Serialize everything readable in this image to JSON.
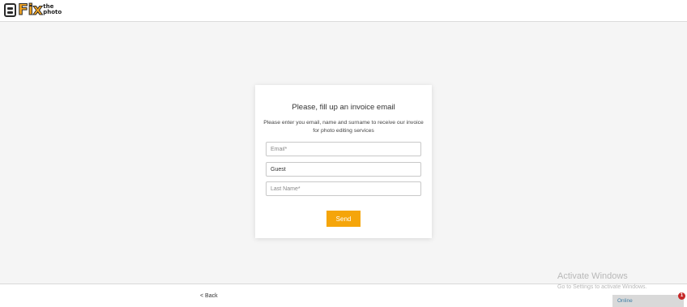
{
  "header": {
    "logo_main": "Fix",
    "logo_small_top": "the",
    "logo_small_bottom": "photo"
  },
  "form": {
    "title": "Please, fill up an invoice email",
    "subtitle": "Please enter you email, name and surname to receive our invoice for photo editing services",
    "email_placeholder": "Email*",
    "name_value": "Guest",
    "lastname_placeholder": "Last Name*",
    "send_label": "Send"
  },
  "footer": {
    "back_label": "< Back"
  },
  "watermark": {
    "title": "Activate Windows",
    "subtitle": "Go to Settings to activate Windows."
  },
  "chat": {
    "status_label": "Online",
    "badge_count": "1"
  },
  "colors": {
    "accent": "#f5a50a",
    "background": "#f5f5f5",
    "badge": "#c62828"
  }
}
